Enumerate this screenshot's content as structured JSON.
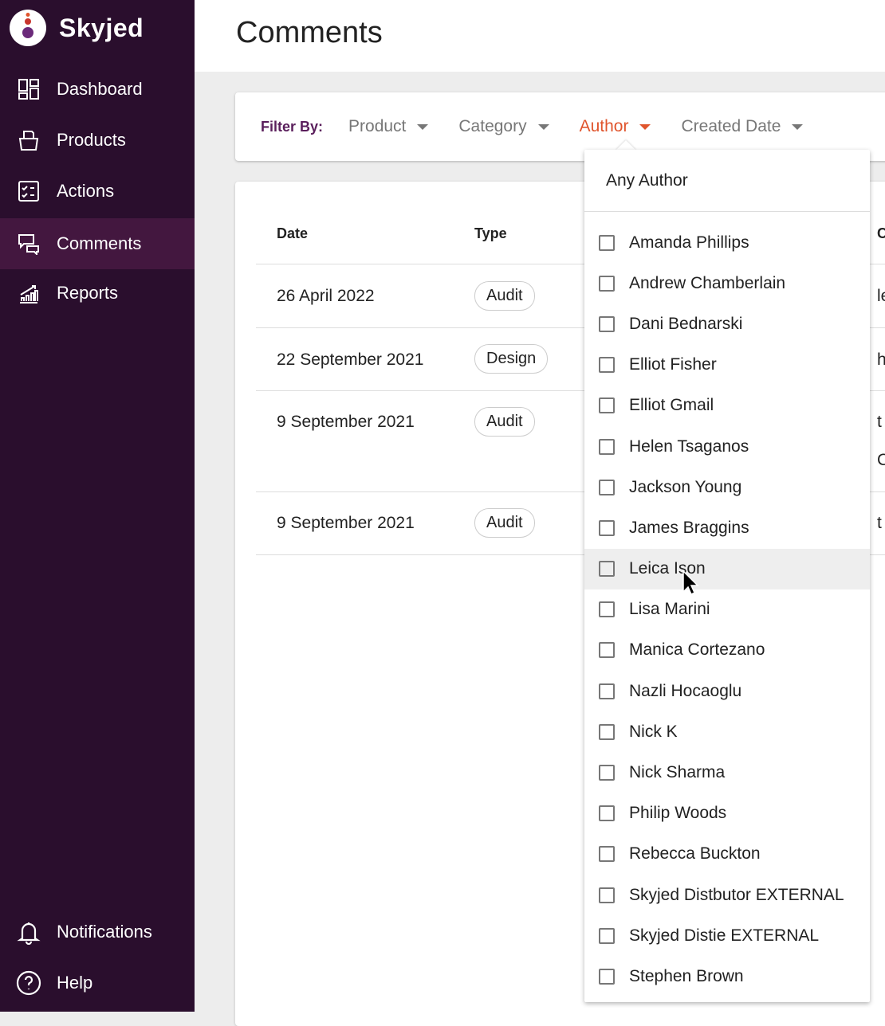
{
  "app": {
    "name": "Skyjed",
    "brand_color": "#2a0e2d",
    "accent": "#e0552d"
  },
  "sidebar": {
    "items": [
      {
        "label": "Dashboard",
        "icon": "dashboard-icon"
      },
      {
        "label": "Products",
        "icon": "folder-icon"
      },
      {
        "label": "Actions",
        "icon": "checklist-icon"
      },
      {
        "label": "Comments",
        "icon": "comments-icon",
        "active": true
      },
      {
        "label": "Reports",
        "icon": "chart-icon"
      }
    ],
    "bottom": [
      {
        "label": "Notifications",
        "icon": "bell-icon"
      },
      {
        "label": "Help",
        "icon": "help-icon"
      }
    ]
  },
  "page": {
    "title": "Comments"
  },
  "filters": {
    "label": "Filter By:",
    "items": [
      "Product",
      "Category",
      "Author",
      "Created Date"
    ],
    "active": "Author"
  },
  "table": {
    "headers": [
      "Date",
      "Type",
      "C"
    ],
    "rows": [
      {
        "date": "26 April 2022",
        "type": "Audit",
        "partial": "le"
      },
      {
        "date": "22 September 2021",
        "type": "Design",
        "partial": "h"
      },
      {
        "date": "9 September 2021",
        "type": "Audit",
        "partial": "t",
        "partial2": "C"
      },
      {
        "date": "9 September 2021",
        "type": "Audit",
        "partial": "t"
      }
    ]
  },
  "author_dropdown": {
    "any": "Any Author",
    "hovered": "Leica Ison",
    "options": [
      "Amanda Phillips",
      "Andrew Chamberlain",
      "Dani Bednarski",
      "Elliot Fisher",
      "Elliot Gmail",
      "Helen Tsaganos",
      "Jackson Young",
      "James Braggins",
      "Leica Ison",
      "Lisa Marini",
      "Manica Cortezano",
      "Nazli Hocaoglu",
      "Nick K",
      "Nick Sharma",
      "Philip Woods",
      "Rebecca Buckton",
      "Skyjed Distbutor EXTERNAL",
      "Skyjed Distie EXTERNAL",
      "Stephen Brown"
    ]
  }
}
